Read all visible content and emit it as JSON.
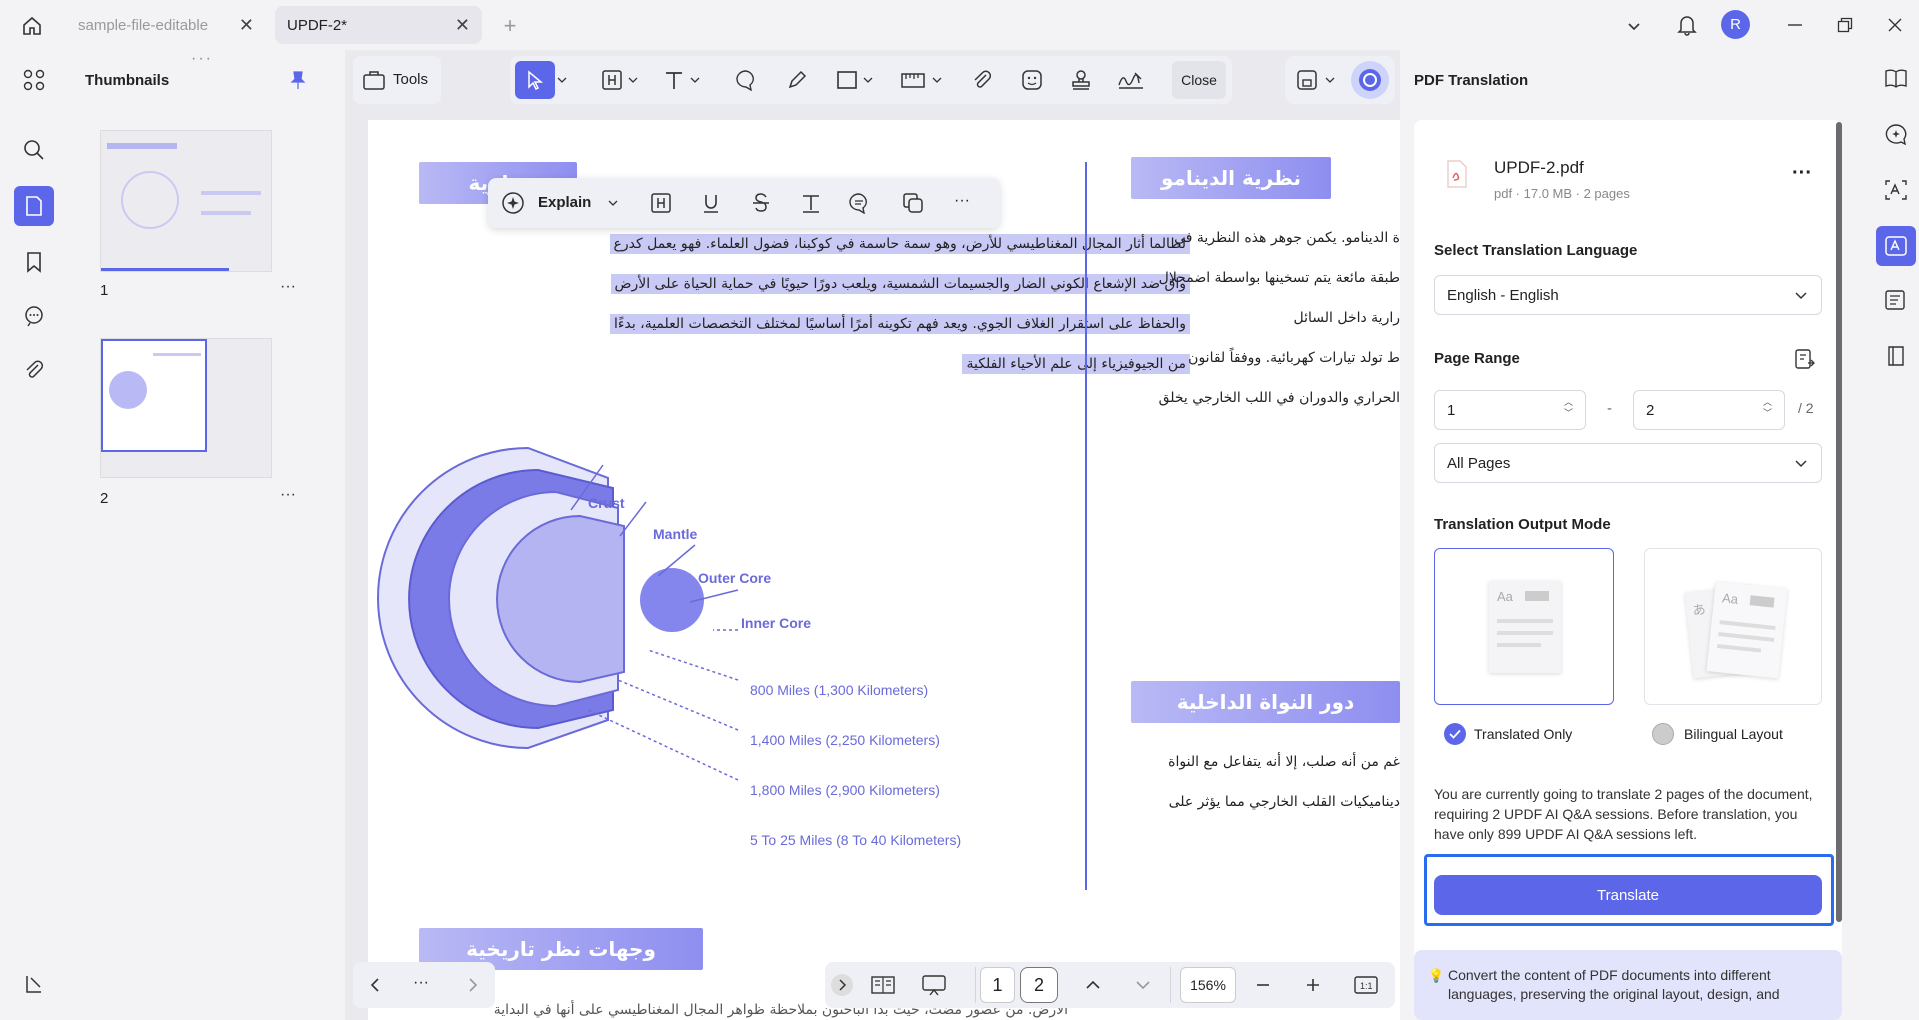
{
  "tabs": [
    {
      "label": "sample-file-editable",
      "active": false
    },
    {
      "label": "UPDF-2*",
      "active": true
    }
  ],
  "window": {
    "user_initial": "R"
  },
  "thumbnails": {
    "title": "Thumbnails",
    "pages": [
      {
        "number": "1"
      },
      {
        "number": "2"
      }
    ]
  },
  "toolbar": {
    "tools_label": "Tools",
    "close_label": "Close"
  },
  "float_toolbar": {
    "explain_label": "Explain"
  },
  "document": {
    "heading_top_left": "نظرية",
    "heading_top_right": "نظرية الدينامو",
    "para_left": [
      "لطالما أثار المجال المغناطيسي للأرض، وهو سمة حاسمة في كوكبنا، فضول العلماء. فهو يعمل كدرع",
      "واق ضد الإشعاع الكوني الضار والجسيمات الشمسية، ويلعب دورًا حيويًا في حماية الحياة على الأرض",
      "والحفاظ على استقرار الغلاف الجوي. ويعد فهم تكوينه أمرًا أساسيًا لمختلف التخصصات العلمية، بدءًا",
      "من الجيوفيزياء إلى علم الأحياء الفلكية"
    ],
    "para_right": [
      "ة الدينامو. يكمن جوهر هذه النظرية في",
      "طبقة مائعة يتم تسخينها بواسطة اضمحلال",
      "رارية داخل السائل",
      "ط تولد تيارات كهربائية. ووفقاً لقانون",
      "الحراري والدوران في اللب الخارجي يخلق"
    ],
    "heading_mid_right": "دور النواة الداخلية",
    "para_right2": [
      "غم من أنه صلب، إلا أنه يتفاعل مع النواة",
      "ديناميكيات القلب الخارجي مما يؤثر على"
    ],
    "heading_bottom_left": "وجهات نظر تاريخية",
    "diagram": {
      "layers": [
        "Crust",
        "Mantle",
        "Outer Core",
        "Inner Core"
      ],
      "distances": [
        "800 Miles (1,300 Kilometers)",
        "1,400 Miles (2,250 Kilometers)",
        "1,800 Miles (2,900 Kilometers)",
        "5 To 25 Miles (8 To 40 Kilometers)"
      ]
    },
    "bottom_text": "الأرض. من عصور مضت، حيث بدأ الباحثون بملاحظة ظواهر المجال المغناطيسي على أنها في البداية"
  },
  "bottom_nav": {
    "current_page": "1",
    "next_page": "2",
    "zoom": "156%"
  },
  "translation_panel": {
    "title": "PDF Translation",
    "file_name": "UPDF-2.pdf",
    "file_meta": "pdf · 17.0 MB · 2 pages",
    "language_label": "Select Translation Language",
    "language_value": "English - English",
    "page_range_label": "Page Range",
    "range_from": "1",
    "range_to": "2",
    "range_total": "/ 2",
    "range_dash": "-",
    "pages_option": "All Pages",
    "output_mode_label": "Translation Output Mode",
    "mode_translated": "Translated Only",
    "mode_bilingual": "Bilingual Layout",
    "mode_selected": "Translated Only",
    "info_text": "You are currently going to translate 2 pages of the document, requiring 2 UPDF AI Q&A sessions. Before translation, you have only 899 UPDF AI Q&A sessions left.",
    "translate_button": "Translate",
    "tip_text": "Convert the content of PDF documents into different languages, preserving the original layout, design, and"
  },
  "colors": {
    "accent": "#5b67e8",
    "highlight": "#c8c9f4",
    "diagram": "#6a6ad8"
  }
}
